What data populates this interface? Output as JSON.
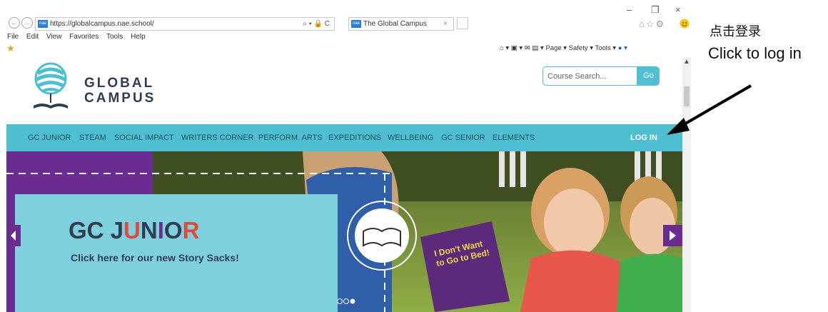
{
  "browser": {
    "url": "https://globalcampus.nae.school/",
    "tab_title": "The Global Campus",
    "tab_close": "×",
    "nav_back": "←",
    "nav_forward": "→",
    "addr_tools": "⌕ ▾ 🔒 C",
    "win_minimize": "–",
    "win_restore": "❐",
    "win_close": "×",
    "right_icons": "⌂☆⚙",
    "menu": [
      "File",
      "Edit",
      "View",
      "Favorites",
      "Tools",
      "Help"
    ],
    "commandbar": "Page ▾   Safety ▾   Tools ▾",
    "favorites_icon": "star-icon"
  },
  "site": {
    "logo_line1": "GLOBAL",
    "logo_line2": "CAMPUS",
    "search_placeholder": "Course Search...",
    "search_button": "Go",
    "nav": [
      "GC JUNIOR",
      "STEAM",
      "SOCIAL IMPACT",
      "WRITERS CORNER",
      "PERFORM. ARTS",
      "EXPEDITIONS",
      "WELLBEING",
      "GC SENIOR",
      "ELEMENTS"
    ],
    "login": "LOG IN",
    "hero": {
      "title_gc": "GC ",
      "title_j": "J",
      "title_u": "U",
      "title_n": "N",
      "title_i": "I",
      "title_o": "O",
      "title_r": "R",
      "subtitle": "Click here for our new Story Sacks!",
      "book_text": "I Don't Want to Go to Bed!"
    }
  },
  "annotation": {
    "zh": "点击登录",
    "en": "Click to log in"
  },
  "colors": {
    "nav_bg": "#4dbfd0",
    "hero_panel": "#7fd0df",
    "purple": "#6a2c91",
    "title_dark": "#2c3e50"
  }
}
